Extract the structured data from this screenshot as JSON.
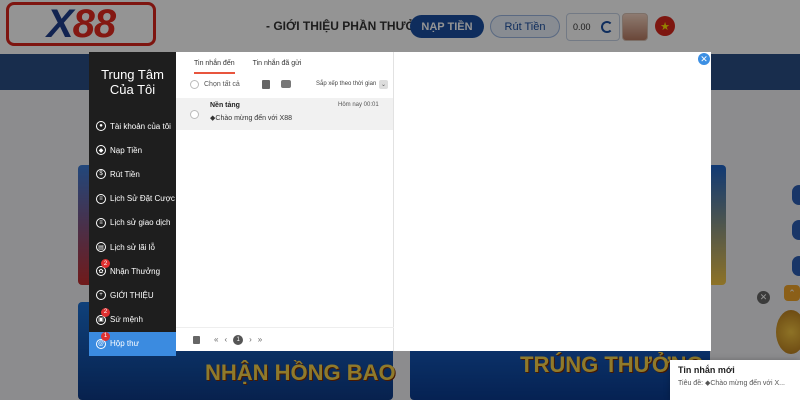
{
  "header": {
    "logo_text_x": "X",
    "logo_text_rest": "88",
    "promo_link": "- GIỚI THIỆU PHẦN THƯỞNG",
    "deposit_button": "NẠP TIỀN",
    "withdraw_button": "Rút Tiền",
    "balance": "0.00"
  },
  "banners": {
    "left_text": "NHẬN HỒNG BAO",
    "right_text": "TRÚNG THƯỞNG"
  },
  "toast": {
    "title": "Tin nhắn mới",
    "body": "Tiêu đề: ◆Chào mừng đến với X..."
  },
  "modal": {
    "sidebar_title": "Trung Tâm Của Tôi",
    "sidebar_items": [
      {
        "label": "Tài khoản của tôi",
        "badge": ""
      },
      {
        "label": "Nạp Tiền",
        "badge": ""
      },
      {
        "label": "Rút Tiền",
        "badge": ""
      },
      {
        "label": "Lịch Sử Đặt Cược",
        "badge": ""
      },
      {
        "label": "Lịch sử giao dịch",
        "badge": ""
      },
      {
        "label": "Lịch sử lãi lỗ",
        "badge": ""
      },
      {
        "label": "Nhận Thưởng",
        "badge": "2"
      },
      {
        "label": "GIỚI THIỆU",
        "badge": ""
      },
      {
        "label": "Sứ mệnh",
        "badge": "2"
      },
      {
        "label": "Hộp thư",
        "badge": "1"
      }
    ],
    "tabs": [
      "Tin nhắn đến",
      "Tin nhắn đã gửi"
    ],
    "select_all": "Chọn tất cả",
    "sort_label": "Sắp xếp theo thời gian",
    "messages": [
      {
        "sender": "Nền tảng",
        "time": "Hôm nay 00:01",
        "subject": "◆Chào mừng đến với X88"
      }
    ],
    "pager": {
      "prev_all": "«",
      "prev": "‹",
      "page": "1",
      "next": "›",
      "next_all": "»"
    }
  }
}
